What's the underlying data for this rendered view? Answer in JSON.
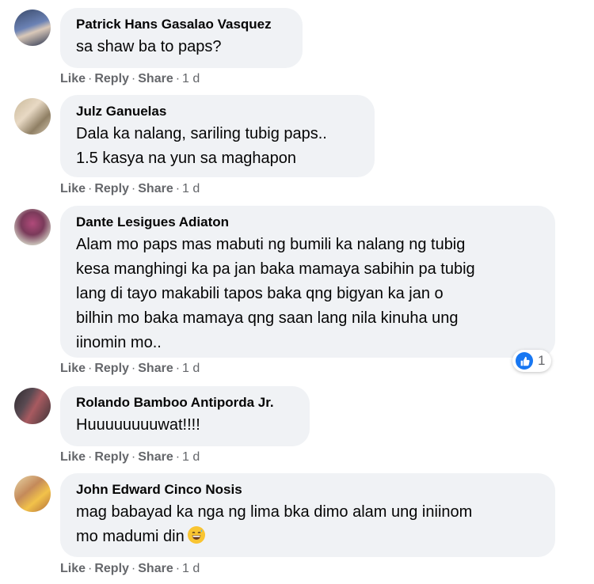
{
  "actions": {
    "like": "Like",
    "reply": "Reply",
    "share": "Share",
    "time": "1 d",
    "dot": "·"
  },
  "comments": [
    {
      "name": "Patrick Hans Gasalao Vasquez",
      "lines": [
        "sa shaw ba to paps?"
      ]
    },
    {
      "name": "Julz Ganuelas",
      "lines": [
        "Dala ka nalang, sariling tubig paps..",
        "1.5 kasya na yun sa maghapon"
      ]
    },
    {
      "name": "Dante Lesigues Adiaton",
      "lines": [
        "Alam mo paps mas mabuti ng bumili ka nalang ng tubig",
        "kesa manghingi ka pa jan baka mamaya sabihin pa tubig",
        "lang di tayo makabili tapos baka qng bigyan ka jan o",
        "bilhin mo baka mamaya qng saan lang nila kinuha ung",
        "iinomin mo.."
      ],
      "reaction_count": "1"
    },
    {
      "name": "Rolando Bamboo Antiporda Jr.",
      "lines": [
        "Huuuuuuuuwat!!!!"
      ]
    },
    {
      "name": "John Edward Cinco Nosis",
      "lines": [
        "mag babayad ka nga ng lima bka dimo alam ung iniinom",
        "mo madumi din"
      ],
      "emoji": "grinning-sweat-emoji"
    }
  ]
}
